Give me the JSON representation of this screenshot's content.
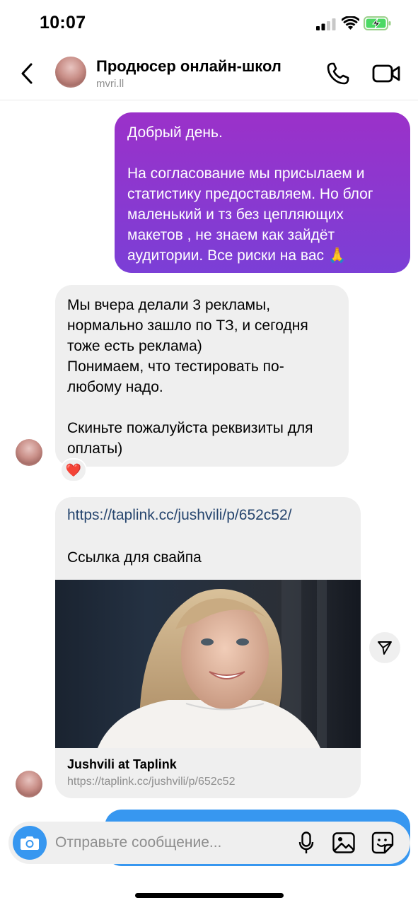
{
  "status_bar": {
    "time": "10:07"
  },
  "header": {
    "title": "Продюсер онлайн-школ",
    "username": "mvri.ll"
  },
  "messages": {
    "outgoing_1": {
      "line_1": "Добрый день.",
      "line_2": "На согласование мы присылаем и статистику предоставляем. Но блог маленький и тз без цепляющих макетов , не знаем как зайдёт аудитории. Все риски на вас 🙏"
    },
    "incoming_1": {
      "line_1": "Мы вчера делали 3 рекламы, нормально зашло по ТЗ, и сегодня тоже есть реклама)",
      "line_2": "Понимаем, что тестировать по-любому надо.",
      "line_3": "Скиньте пожалуйста реквизиты для оплаты)",
      "reaction": "❤️"
    },
    "incoming_link": {
      "url": "https://taplink.cc/jushvili/p/652c52/",
      "caption": "Ссылка для свайпа",
      "preview_title": "Jushvili at Taplink",
      "preview_url": "https://taplink.cc/jushvili/p/652c52"
    }
  },
  "composer": {
    "placeholder": "Отправьте сообщение..."
  },
  "colors": {
    "outgoing_gradient_top": "#9b31c9",
    "outgoing_gradient_bottom": "#7b3fd6",
    "incoming_bg": "#efefef",
    "accent_blue": "#3797f0",
    "link_color": "#26456e"
  },
  "icons": {
    "back": "chevron-left-icon",
    "call": "phone-icon",
    "video": "video-camera-icon",
    "share": "paper-plane-icon",
    "camera": "camera-icon",
    "mic": "microphone-icon",
    "gallery": "image-icon",
    "sticker": "sticker-icon"
  }
}
